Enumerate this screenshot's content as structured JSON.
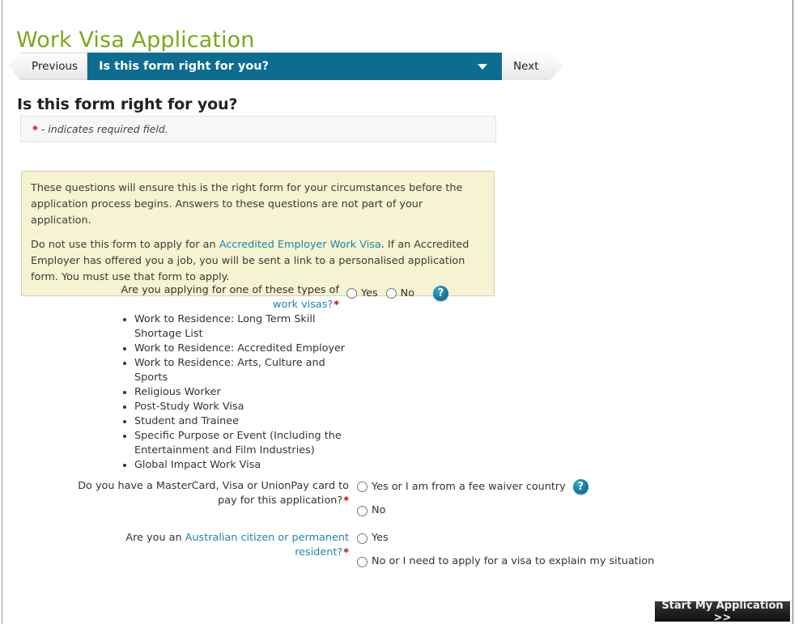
{
  "page": {
    "title": "Work Visa Application",
    "section_heading": "Is this form right for you?",
    "title_color": "#7fa71a",
    "accent_color": "#0d6d91",
    "link_color": "#1e87a8",
    "required_color": "#cc0000"
  },
  "wizard": {
    "previous_label": "Previous",
    "current_step_label": "Is this form right for you?",
    "next_label": "Next",
    "caret_icon": "chevron-down-icon"
  },
  "required_notice": {
    "marker": "*",
    "text": "- indicates required field."
  },
  "info_box": {
    "paragraph1": "These questions will ensure this is the right form for your circumstances before the application process begins. Answers to these questions are not part of your application.",
    "paragraph2_part1": "Do not use this form to apply for an ",
    "paragraph2_link": "Accredited Employer Work Visa",
    "paragraph2_part2": ". If an Accredited Employer has offered you a job, you will be sent a link to a personalised application form. You must use that form to apply."
  },
  "questions": {
    "work_visa_types": {
      "label_part1": "Are you applying for one of these types of ",
      "label_link": "work visas?",
      "required": "*",
      "help_icon": "help-icon",
      "options": [
        "Yes",
        "No"
      ],
      "visa_list": [
        "Work to Residence: Long Term Skill Shortage List",
        "Work to Residence: Accredited Employer",
        "Work to Residence: Arts, Culture and Sports",
        "Religious Worker",
        "Post-Study Work Visa",
        "Student and Trainee",
        "Specific Purpose or Event (Including the Entertainment and Film Industries)",
        "Global Impact Work Visa"
      ]
    },
    "payment_card": {
      "label": "Do you have a MasterCard, Visa or UnionPay card to pay for this application?",
      "required": "*",
      "help_icon": "help-icon",
      "options": [
        "Yes or I am from a fee waiver country",
        "No"
      ]
    },
    "australian_citizen": {
      "label_part1": "Are you an ",
      "label_link": "Australian citizen or permanent resident?",
      "required": "*",
      "options": [
        "Yes",
        "No or I need to apply for a visa to explain my situation"
      ]
    }
  },
  "submit": {
    "label": "Start My Application >>"
  }
}
